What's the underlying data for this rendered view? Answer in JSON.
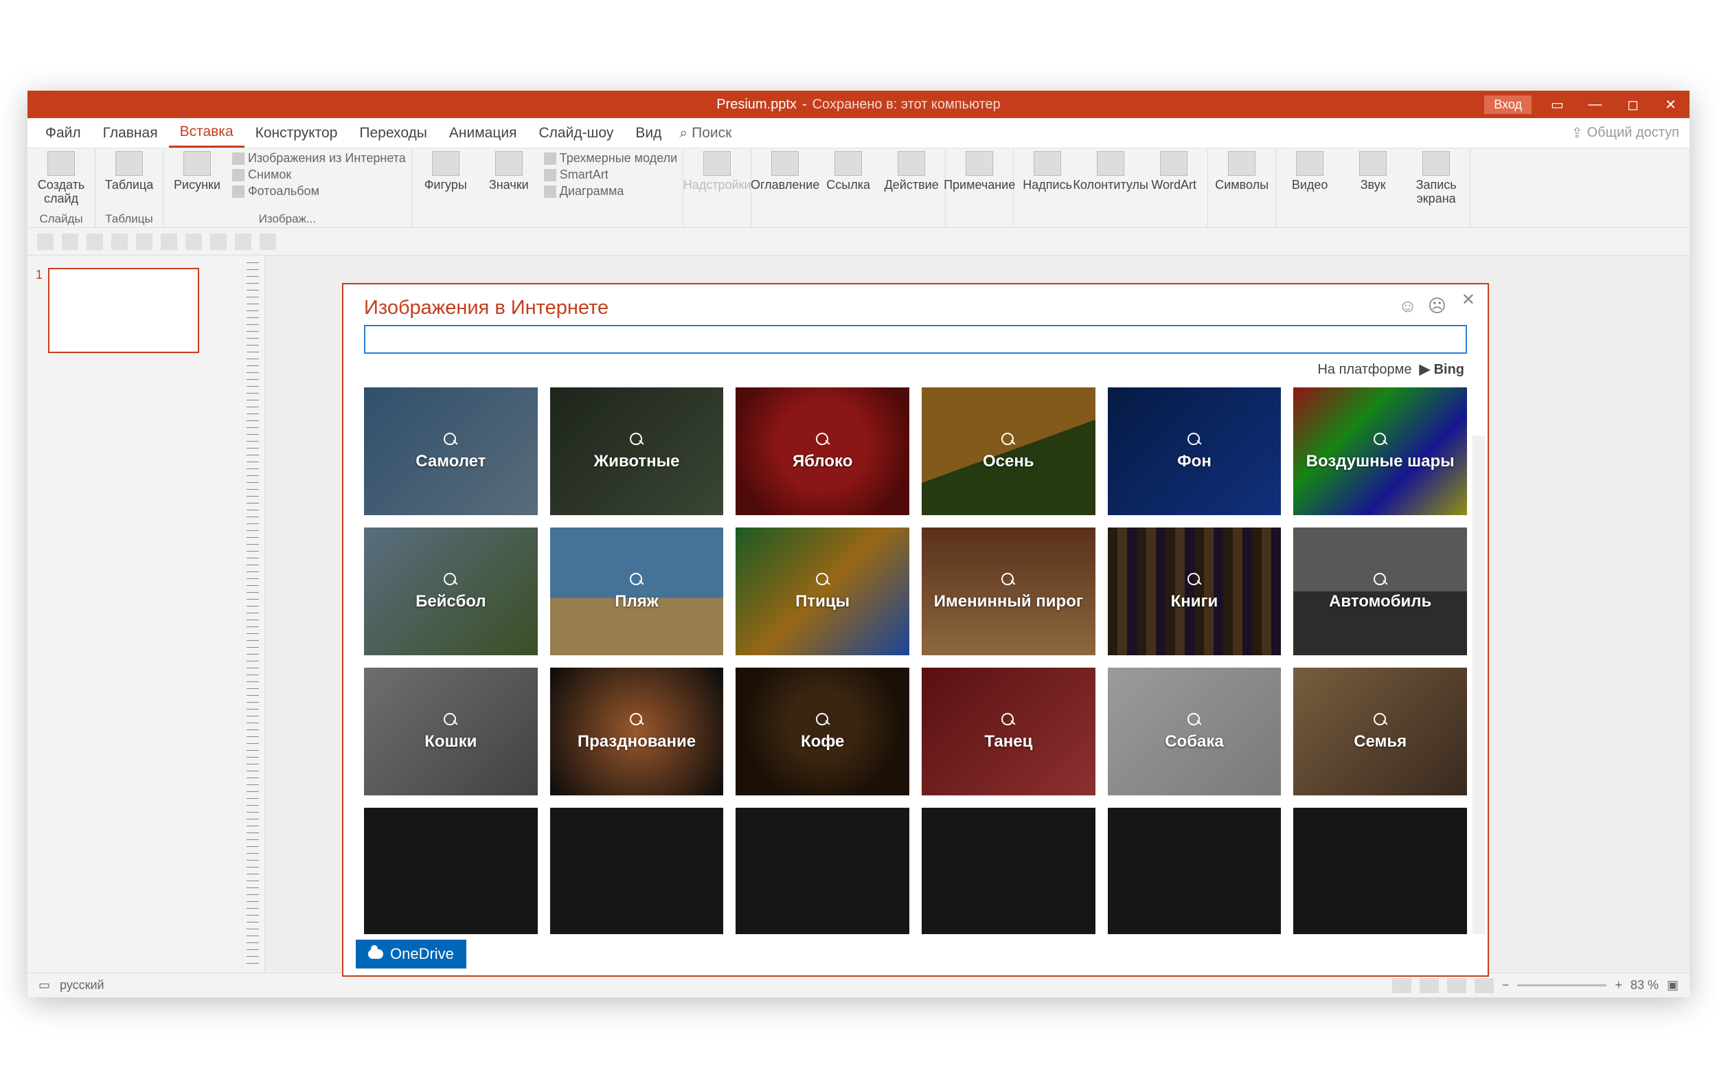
{
  "window": {
    "filename": "Presium.pptx",
    "saved_status": "Сохранено в: этот компьютер",
    "login": "Вход"
  },
  "menubar": {
    "tabs": [
      "Файл",
      "Главная",
      "Вставка",
      "Конструктор",
      "Переходы",
      "Анимация",
      "Слайд-шоу",
      "Вид"
    ],
    "active_index": 2,
    "search": "Поиск",
    "share": "Общий доступ"
  },
  "ribbon": {
    "groups": {
      "slides": {
        "label": "Слайды",
        "new_slide": "Создать слайд"
      },
      "tables": {
        "label": "Таблицы",
        "table": "Таблица"
      },
      "images": {
        "label": "Изображ...",
        "pictures": "Рисунки",
        "online": "Изображения из Интернета",
        "screenshot": "Снимок",
        "album": "Фотоальбом"
      },
      "illustr": {
        "shapes": "Фигуры",
        "icons": "Значки",
        "models": "Трехмерные модели",
        "smartart": "SmartArt",
        "chart": "Диаграмма"
      },
      "addins": {
        "label": "Надстройки"
      },
      "links": {
        "toc": "Оглавление",
        "link": "Ссылка",
        "action": "Действие"
      },
      "comment": {
        "comment": "Примечание"
      },
      "text": {
        "textbox": "Надпись",
        "headerfooter": "Колонтитулы",
        "wordart": "WordArt"
      },
      "symbols": {
        "symbols": "Символы"
      },
      "media": {
        "video": "Видео",
        "audio": "Звук",
        "screenrec": "Запись экрана"
      }
    }
  },
  "thumbs": {
    "num1": "1"
  },
  "dialog": {
    "title": "Изображения в Интернете",
    "powered_prefix": "На платформе",
    "powered_brand": "Bing",
    "onedrive": "OneDrive",
    "search_placeholder": "",
    "categories": [
      {
        "label": "Самолет",
        "bg": "bg-plane"
      },
      {
        "label": "Животные",
        "bg": "bg-animals"
      },
      {
        "label": "Яблоко",
        "bg": "bg-apple"
      },
      {
        "label": "Осень",
        "bg": "bg-autumn"
      },
      {
        "label": "Фон",
        "bg": "bg-bg"
      },
      {
        "label": "Воздушные шары",
        "bg": "bg-balloons"
      },
      {
        "label": "Бейсбол",
        "bg": "bg-baseball"
      },
      {
        "label": "Пляж",
        "bg": "bg-beach"
      },
      {
        "label": "Птицы",
        "bg": "bg-birds"
      },
      {
        "label": "Именинный пирог",
        "bg": "bg-cake"
      },
      {
        "label": "Книги",
        "bg": "bg-books"
      },
      {
        "label": "Автомобиль",
        "bg": "bg-car"
      },
      {
        "label": "Кошки",
        "bg": "bg-cats"
      },
      {
        "label": "Празднование",
        "bg": "bg-celebr"
      },
      {
        "label": "Кофе",
        "bg": "bg-coffee"
      },
      {
        "label": "Танец",
        "bg": "bg-dance"
      },
      {
        "label": "Собака",
        "bg": "bg-dog"
      },
      {
        "label": "Семья",
        "bg": "bg-family"
      },
      {
        "label": "",
        "bg": "bg-dark"
      },
      {
        "label": "",
        "bg": "bg-dark"
      },
      {
        "label": "",
        "bg": "bg-dark"
      },
      {
        "label": "",
        "bg": "bg-dark"
      },
      {
        "label": "",
        "bg": "bg-dark"
      },
      {
        "label": "",
        "bg": "bg-dark"
      }
    ]
  },
  "statusbar": {
    "lang": "русский",
    "zoom": "83 %"
  }
}
